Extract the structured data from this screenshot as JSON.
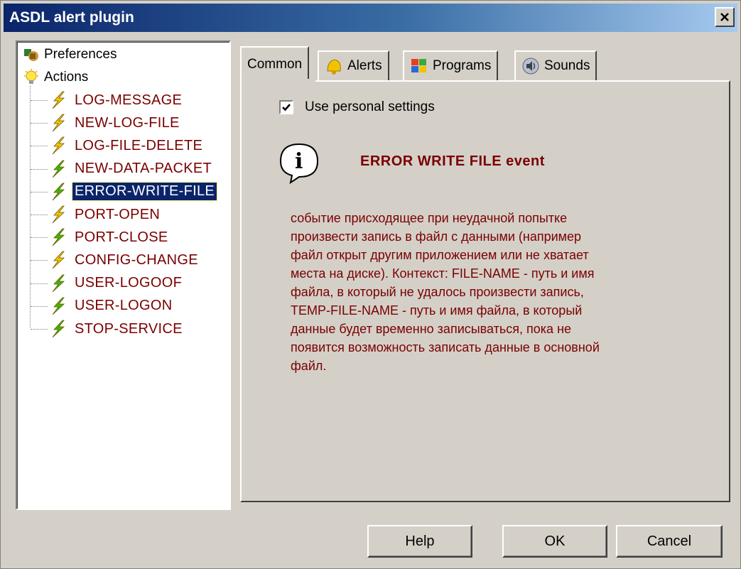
{
  "window": {
    "title": "ASDL alert plugin"
  },
  "tree": {
    "roots": [
      {
        "label": "Preferences",
        "icon": "preferences-icon"
      },
      {
        "label": "Actions",
        "icon": "lightbulb-icon"
      }
    ],
    "items": [
      {
        "label": "LOG-MESSAGE",
        "bolt": "yellow"
      },
      {
        "label": "NEW-LOG-FILE",
        "bolt": "yellow"
      },
      {
        "label": "LOG-FILE-DELETE",
        "bolt": "yellow"
      },
      {
        "label": "NEW-DATA-PACKET",
        "bolt": "green"
      },
      {
        "label": "ERROR-WRITE-FILE",
        "bolt": "green",
        "selected": true
      },
      {
        "label": "PORT-OPEN",
        "bolt": "yellow"
      },
      {
        "label": "PORT-CLOSE",
        "bolt": "green"
      },
      {
        "label": "CONFIG-CHANGE",
        "bolt": "yellow"
      },
      {
        "label": "USER-LOGOOF",
        "bolt": "green"
      },
      {
        "label": "USER-LOGON",
        "bolt": "green"
      },
      {
        "label": "STOP-SERVICE",
        "bolt": "green"
      }
    ]
  },
  "tabs": [
    {
      "label": "Common",
      "active": true
    },
    {
      "label": "Alerts",
      "icon": "bell-icon"
    },
    {
      "label": "Programs",
      "icon": "windows-logo-icon"
    },
    {
      "label": "Sounds",
      "icon": "speaker-icon"
    }
  ],
  "common": {
    "use_personal_settings_label": "Use personal settings",
    "use_personal_settings_checked": true,
    "event_title": "ERROR WRITE FILE event",
    "description_lines": [
      "событие присходящее при неудачной попытке",
      "произвести запись в файл с данными (например",
      "файл открыт другим приложением или не хватает",
      "места на диске). Контекст: FILE-NAME - путь и имя",
      "файла, в который не удалось произвести запись,",
      "TEMP-FILE-NAME - путь и имя файла, в который",
      "данные будет временно записываться, пока не",
      "появится возможность записать данные в основной",
      "файл."
    ]
  },
  "buttons": {
    "help": "Help",
    "ok": "OK",
    "cancel": "Cancel"
  },
  "colors": {
    "title_bar": "#0a246a",
    "accent_text": "#7a0000",
    "bolt_yellow": "#f5c400",
    "bolt_green": "#3cb800"
  }
}
